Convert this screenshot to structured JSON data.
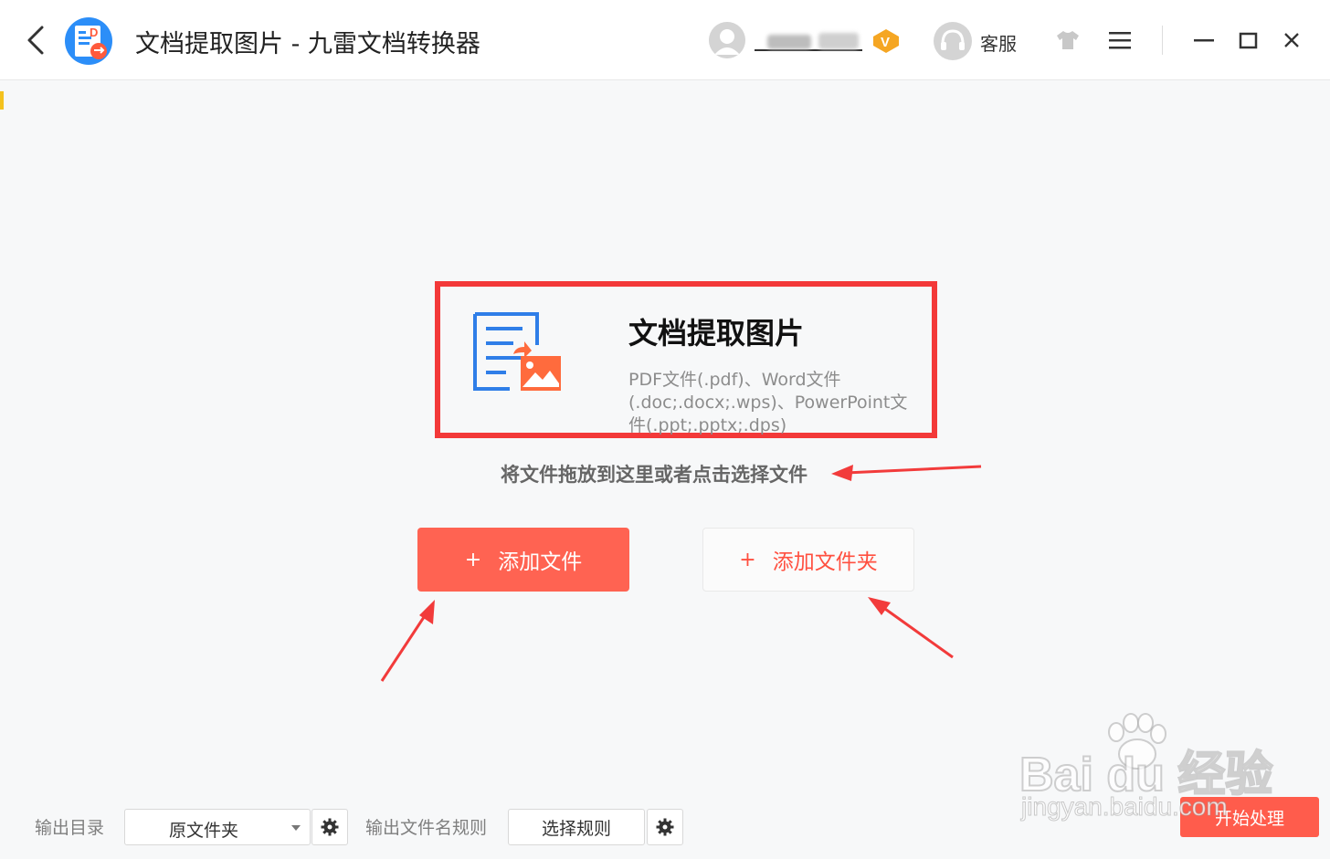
{
  "window": {
    "title": "文档提取图片 - 九雷文档转换器",
    "service_label": "客服",
    "vip_badge": "V"
  },
  "feature": {
    "title": "文档提取图片",
    "description": "PDF文件(.pdf)、Word文件(.doc;.docx;.wps)、PowerPoint文件(.ppt;.pptx;.dps)"
  },
  "drop_hint": "将文件拖放到这里或者点击选择文件",
  "actions": {
    "add_file": "添加文件",
    "add_folder": "添加文件夹",
    "plus": "+"
  },
  "footer": {
    "output_dir_label": "输出目录",
    "output_dir_value": "原文件夹",
    "filename_rule_label": "输出文件名规则",
    "filename_rule_button": "选择规则",
    "start_button": "开始处理"
  },
  "watermark": {
    "line1": "Bai du 经验",
    "line2": "jingyan.baidu.com"
  },
  "colors": {
    "accent": "#ff6352",
    "highlight_box": "#f33939",
    "vip": "#f5a623"
  }
}
